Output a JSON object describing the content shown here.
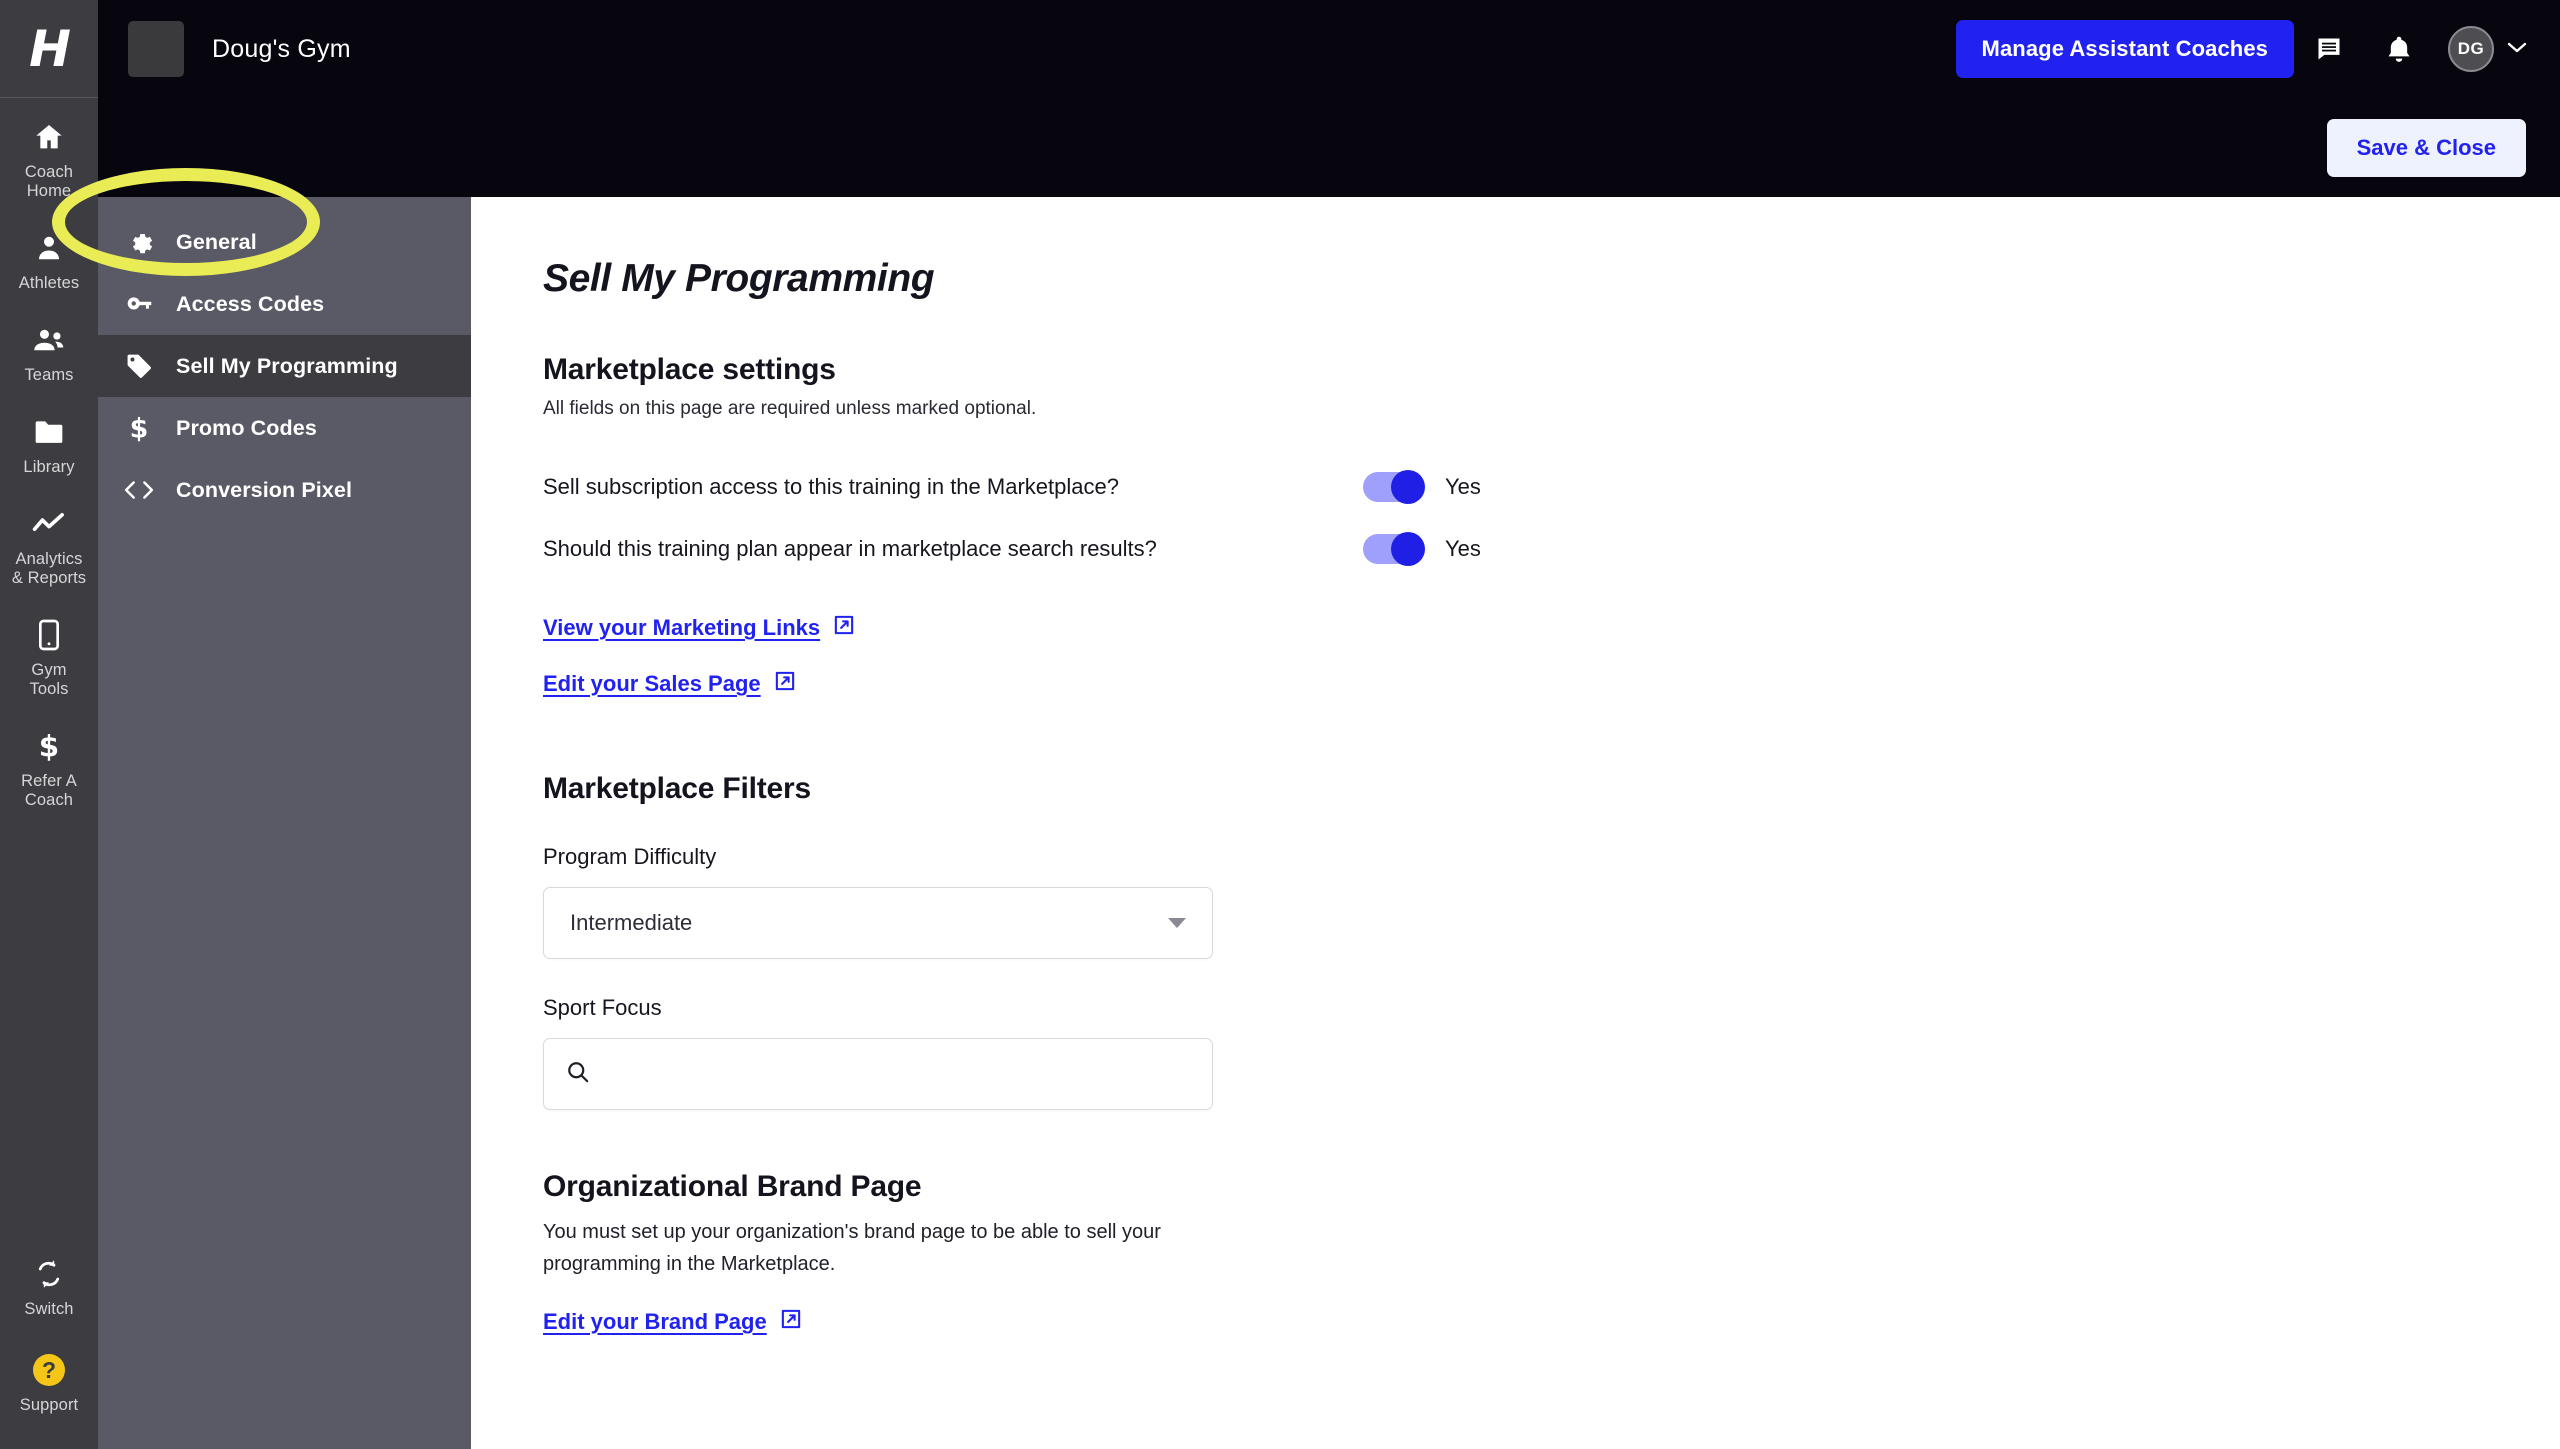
{
  "rail": {
    "logo_text": "H",
    "items": [
      {
        "label": "Coach\nHome",
        "icon": "home-icon"
      },
      {
        "label": "Athletes",
        "icon": "person-icon"
      },
      {
        "label": "Teams",
        "icon": "people-icon"
      },
      {
        "label": "Library",
        "icon": "folder-icon"
      },
      {
        "label": "Analytics\n& Reports",
        "icon": "chart-line-icon"
      },
      {
        "label": "Gym\nTools",
        "icon": "phone-icon"
      },
      {
        "label": "Refer A\nCoach",
        "icon": "dollar-icon"
      }
    ],
    "bottom": [
      {
        "label": "Switch",
        "icon": "switch-icon"
      },
      {
        "label": "Support",
        "icon": "question-icon",
        "badge": "?"
      }
    ]
  },
  "header": {
    "gym_name": "Doug's Gym",
    "manage_coaches_label": "Manage Assistant Coaches",
    "avatar_initials": "DG",
    "save_close_label": "Save & Close"
  },
  "subnav": {
    "items": [
      {
        "label": "General",
        "icon": "gear-icon",
        "active": false
      },
      {
        "label": "Access Codes",
        "icon": "key-icon",
        "active": false
      },
      {
        "label": "Sell My Programming",
        "icon": "tag-icon",
        "active": true
      },
      {
        "label": "Promo Codes",
        "icon": "dollar-tag-icon",
        "active": false
      },
      {
        "label": "Conversion Pixel",
        "icon": "code-brackets-icon",
        "active": false
      }
    ]
  },
  "main": {
    "page_title": "Sell My Programming",
    "marketplace_settings": {
      "heading": "Marketplace settings",
      "subtitle": "All fields on this page are required unless marked optional.",
      "toggles": [
        {
          "question": "Sell subscription access to this training in the Marketplace?",
          "value": "Yes",
          "on": true
        },
        {
          "question": "Should this training plan appear in marketplace search results?",
          "value": "Yes",
          "on": true
        }
      ],
      "links": [
        {
          "label": "View your Marketing Links"
        },
        {
          "label": "Edit your Sales Page"
        }
      ]
    },
    "marketplace_filters": {
      "heading": "Marketplace Filters",
      "program_difficulty": {
        "label": "Program Difficulty",
        "value": "Intermediate"
      },
      "sport_focus": {
        "label": "Sport Focus",
        "value": "",
        "placeholder": ""
      }
    },
    "brand_page": {
      "heading": "Organizational Brand Page",
      "description": "You must set up your organization's brand page to be able to sell your programming in the Marketplace.",
      "link_label": "Edit your Brand Page"
    }
  },
  "annotation": {
    "type": "ellipse-highlight",
    "color": "#e9ec54",
    "target": "Sell My Programming"
  },
  "colors": {
    "brand_blue": "#2121f0",
    "rail_bg": "#3c3c41",
    "subnav_bg": "#5a5a66",
    "topbar_bg": "#07060f",
    "annotation_yellow": "#e9ec54",
    "support_yellow": "#f5c518"
  }
}
